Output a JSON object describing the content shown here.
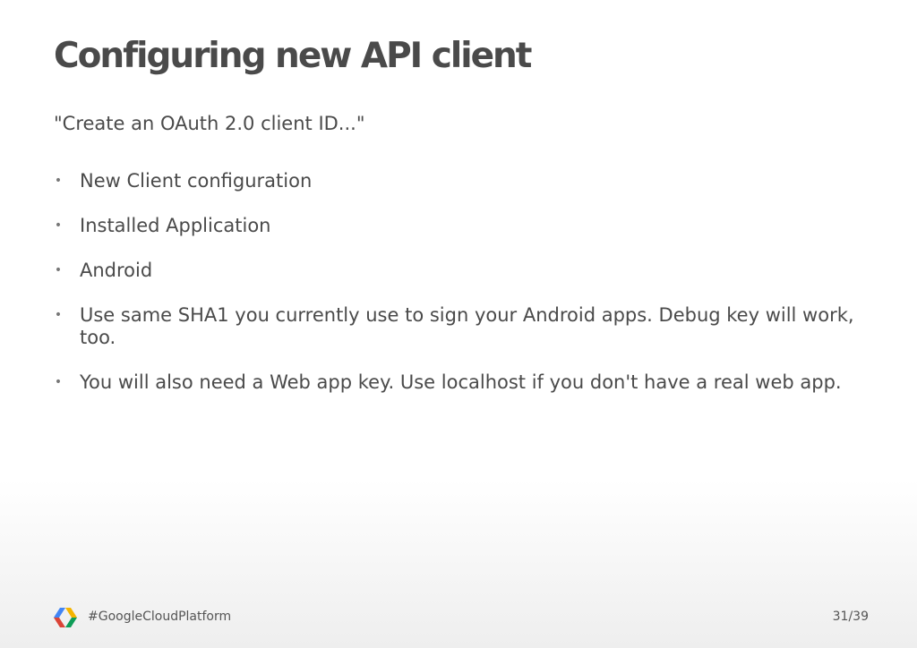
{
  "slide": {
    "title": "Configuring new API client",
    "subtitle": "\"Create an OAuth 2.0 client ID...\"",
    "bullets": [
      "New Client configuration",
      "Installed Application",
      "Android",
      "Use same SHA1 you currently use to sign your Android apps. Debug key will work, too.",
      "You will also need a Web app key. Use localhost if you don't have a real web app."
    ]
  },
  "footer": {
    "logo_icon": "google-cloud-platform-logo-icon",
    "hashtag": "#GoogleCloudPlatform",
    "page_number": "31/39"
  },
  "colors": {
    "logo_blue": "#4285f4",
    "logo_red": "#db4437",
    "logo_yellow": "#f4b400",
    "logo_green": "#0f9d58"
  }
}
